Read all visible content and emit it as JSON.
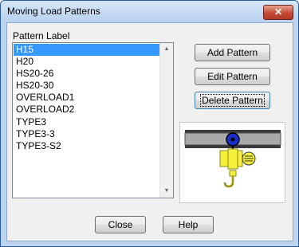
{
  "window": {
    "title": "Moving Load Patterns",
    "close_glyph": "✕"
  },
  "list": {
    "label": "Pattern Label",
    "items": [
      "H15",
      "H20",
      "HS20-26",
      "HS20-30",
      "OVERLOAD1",
      "OVERLOAD2",
      "TYPE3",
      "TYPE3-3",
      "TYPE3-S2"
    ],
    "selected": "H15"
  },
  "buttons": {
    "add": "Add Pattern",
    "edit": "Edit Pattern",
    "delete": "Delete Pattern",
    "close": "Close",
    "help": "Help"
  },
  "preview": {
    "icon": "crane-hoist-icon"
  },
  "colors": {
    "selection": "#3399ff",
    "title_bar": "#b9d1ee",
    "hoist_yellow": "#f5f03a",
    "trolley_blue": "#1a2ecc"
  }
}
